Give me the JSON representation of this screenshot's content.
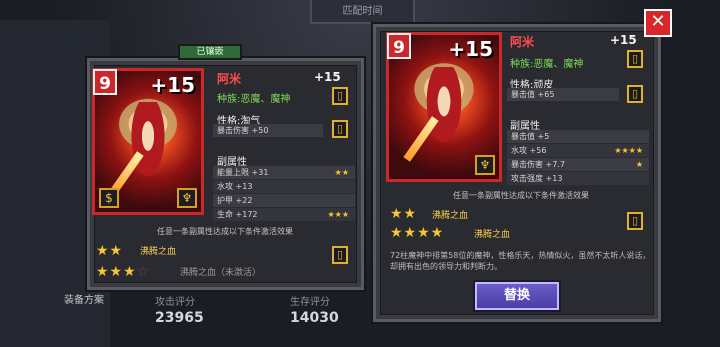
{
  "background": {
    "top_tab": "匹配时间",
    "scheme_label": "装备方案",
    "attack_score": {
      "label": "攻击评分",
      "value": "23965"
    },
    "survival_score": {
      "label": "生存评分",
      "value": "14030"
    }
  },
  "left_card": {
    "equipped_tag": "已镶嵌",
    "level_badge": "9",
    "plus": "+15",
    "name": "阿米",
    "enhance": "+15",
    "race": "种族:恶魔、魔神",
    "personality_title": "性格:淘气",
    "personality_rows": [
      {
        "text": "暴击伤害 +50",
        "stars": ""
      }
    ],
    "sub_title": "副属性",
    "sub_rows": [
      {
        "text": "能量上限 +31",
        "stars": "★★"
      },
      {
        "text": "水攻 +13",
        "stars": ""
      },
      {
        "text": "护甲 +22",
        "stars": ""
      },
      {
        "text": "生命 +172",
        "stars": "★★★"
      }
    ],
    "hint": "任意一条副属性达成以下条件激活效果",
    "set_effects": [
      {
        "stars": "★★",
        "label": "沸腾之血",
        "active": true
      },
      {
        "stars": "★★★",
        "dim": "☆",
        "label": "沸腾之血（未激活）",
        "active": false
      }
    ]
  },
  "right_card": {
    "level_badge": "9",
    "plus": "+15",
    "name": "阿米",
    "enhance": "+15",
    "race": "种族:恶魔、魔神",
    "personality_title": "性格:顽皮",
    "personality_rows": [
      {
        "text": "暴击值 +65",
        "stars": ""
      }
    ],
    "sub_title": "副属性",
    "sub_rows": [
      {
        "text": "暴击值 +5",
        "stars": ""
      },
      {
        "text": "水攻 +56",
        "stars": "★★★★"
      },
      {
        "text": "暴击伤害 +7.7",
        "stars": "★"
      },
      {
        "text": "攻击强度 +13",
        "stars": ""
      }
    ],
    "hint": "任意一条副属性达成以下条件激活效果",
    "set_effects": [
      {
        "stars": "★★",
        "label": "沸腾之血",
        "active": true
      },
      {
        "stars": "★★★★",
        "label": "沸腾之血",
        "active": true
      }
    ],
    "description": "72柱魔神中排第58位的魔神，性格乐天，热情似火，虽然不太听人说话，却拥有出色的领导力和判断力。",
    "replace_button": "替换"
  },
  "close_icon": "close-icon",
  "colors": {
    "accent_red": "#c9282c",
    "star": "#f7c531",
    "race_green": "#7ed957",
    "button_purple": "#5a4db8"
  }
}
